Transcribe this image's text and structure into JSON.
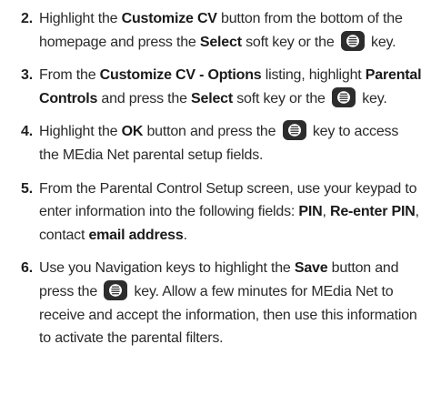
{
  "steps": [
    {
      "number": "2.",
      "parts": [
        {
          "t": "Highlight the "
        },
        {
          "t": "Customize CV",
          "b": true
        },
        {
          "t": " button from the bottom of the homepage and press the "
        },
        {
          "t": "Select",
          "b": true
        },
        {
          "t": " soft key or the "
        },
        {
          "icon": "select-key-icon"
        },
        {
          "t": " key."
        }
      ]
    },
    {
      "number": "3.",
      "parts": [
        {
          "t": "From the "
        },
        {
          "t": "Customize CV - Options",
          "b": true
        },
        {
          "t": " listing, highlight "
        },
        {
          "t": "Parental Controls",
          "b": true
        },
        {
          "t": " and press the "
        },
        {
          "t": "Select",
          "b": true
        },
        {
          "t": " soft key or the "
        },
        {
          "icon": "select-key-icon"
        },
        {
          "t": " key."
        }
      ]
    },
    {
      "number": "4.",
      "parts": [
        {
          "t": "Highlight the "
        },
        {
          "t": "OK",
          "b": true
        },
        {
          "t": " button and press the "
        },
        {
          "icon": "select-key-icon"
        },
        {
          "t": " key to access the MEdia Net parental setup fields."
        }
      ]
    },
    {
      "number": "5.",
      "parts": [
        {
          "t": "From the Parental Control Setup screen, use your keypad to enter information into the following fields: "
        },
        {
          "t": "PIN",
          "b": true
        },
        {
          "t": ", "
        },
        {
          "t": "Re-enter PIN",
          "b": true
        },
        {
          "t": ", contact "
        },
        {
          "t": "email address",
          "b": true
        },
        {
          "t": "."
        }
      ]
    },
    {
      "number": "6.",
      "parts": [
        {
          "t": "Use you Navigation keys to highlight the "
        },
        {
          "t": "Save",
          "b": true
        },
        {
          "t": " button and press the "
        },
        {
          "icon": "select-key-icon"
        },
        {
          "t": " key. Allow a few minutes for MEdia Net to receive and accept the information, then use this information to activate the parental filters."
        }
      ]
    }
  ]
}
